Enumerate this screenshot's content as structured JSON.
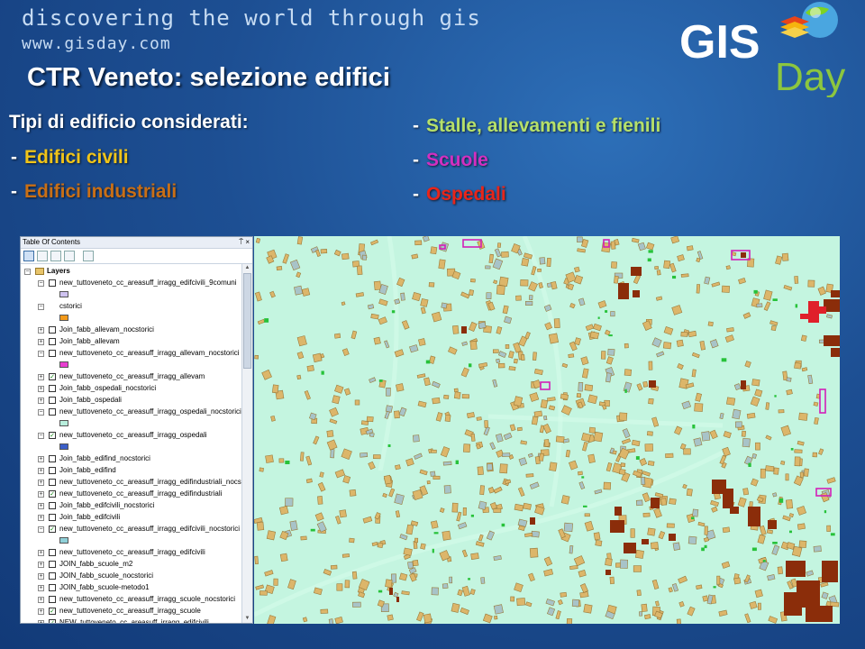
{
  "header": {
    "tagline": "discovering the world through gis",
    "url": "www.gisday.com",
    "logo_text_1": "GIS",
    "logo_text_2": "Day"
  },
  "slide": {
    "title": "CTR Veneto: selezione edifici",
    "intro": "Tipi di edificio considerati:",
    "left_items": [
      {
        "label": "Edifici civili",
        "color": "#f0c419"
      },
      {
        "label": "Edifici industriali",
        "color": "#c96f16"
      }
    ],
    "right_items": [
      {
        "label": "Stalle, allevamenti e fienili",
        "color": "#b6e06a"
      },
      {
        "label": "Scuole",
        "color": "#d22fc0"
      },
      {
        "label": "Ospedali",
        "color": "#e8251a"
      }
    ]
  },
  "toc": {
    "title": "Table Of Contents",
    "controls": "⍑ ×",
    "root_label": "Layers",
    "items": [
      {
        "label": "new_tuttoveneto_cc_areasuff_irragg_edifcivili_9comuni",
        "expanded": true,
        "checked": false,
        "swatch": "#cfc3f0"
      },
      {
        "label": "cstorici",
        "expanded": true,
        "checked": false,
        "no_checkbox": true,
        "swatch": "#f39a1a"
      },
      {
        "label": "Join_fabb_allevam_nocstorici",
        "expanded": false,
        "checked": false
      },
      {
        "label": "Join_fabb_allevam",
        "expanded": false,
        "checked": false
      },
      {
        "label": "new_tuttoveneto_cc_areasuff_irragg_allevam_nocstorici",
        "expanded": true,
        "checked": false,
        "swatch": "#e83fd0"
      },
      {
        "label": "new_tuttoveneto_cc_areasuff_irragg_allevam",
        "expanded": false,
        "checked": true
      },
      {
        "label": "Join_fabb_ospedali_nocstorici",
        "expanded": false,
        "checked": false
      },
      {
        "label": "Join_fabb_ospedali",
        "expanded": false,
        "checked": false
      },
      {
        "label": "new_tuttoveneto_cc_areasuff_irragg_ospedali_nocstorici",
        "expanded": true,
        "checked": false,
        "swatch": "#b8eedc"
      },
      {
        "label": "new_tuttoveneto_cc_areasuff_irragg_ospedali",
        "expanded": true,
        "checked": true,
        "swatch": "#3b5fc8"
      },
      {
        "label": "Join_fabb_edifind_nocstorici",
        "expanded": false,
        "checked": false
      },
      {
        "label": "Join_fabb_edifind",
        "expanded": false,
        "checked": false
      },
      {
        "label": "new_tuttoveneto_cc_areasuff_irragg_edifindustriali_nocstorici",
        "expanded": false,
        "checked": false
      },
      {
        "label": "new_tuttoveneto_cc_areasuff_irragg_edifindustriali",
        "expanded": false,
        "checked": true
      },
      {
        "label": "Join_fabb_edifcivili_nocstorici",
        "expanded": false,
        "checked": false
      },
      {
        "label": "Join_fabb_edifcivili",
        "expanded": false,
        "checked": false
      },
      {
        "label": "new_tuttoveneto_cc_areasuff_irragg_edifcivili_nocstorici",
        "expanded": true,
        "checked": true,
        "swatch": "#8fd0d8"
      },
      {
        "label": "new_tuttoveneto_cc_areasuff_irragg_edifcivili",
        "expanded": false,
        "checked": false
      },
      {
        "label": "JOIN_fabb_scuole_m2",
        "expanded": false,
        "checked": false
      },
      {
        "label": "JOIN_fabb_scuole_nocstorici",
        "expanded": false,
        "checked": false
      },
      {
        "label": "JOIN_fabb_scuole-metodo1",
        "expanded": false,
        "checked": false
      },
      {
        "label": "new_tuttoveneto_cc_areasuff_irragg_scuole_nocstorici",
        "expanded": false,
        "checked": false
      },
      {
        "label": "new_tuttoveneto_cc_areasuff_irragg_scuole",
        "expanded": false,
        "checked": true
      },
      {
        "label": "NEW_tuttoveneto_cc_areasuff_irragg_edifcivili",
        "expanded": false,
        "checked": true
      }
    ]
  },
  "map": {
    "background": "#c4f5e0",
    "colors": {
      "civili": "#dcb66a",
      "civili_outline": "#9a7a3a",
      "blue_grey": "#a8c3c8",
      "industriali": "#8b2d0a",
      "allevamenti": "#27c23a",
      "ospedali": "#e0202a",
      "scuole": "#d21fb8"
    }
  }
}
